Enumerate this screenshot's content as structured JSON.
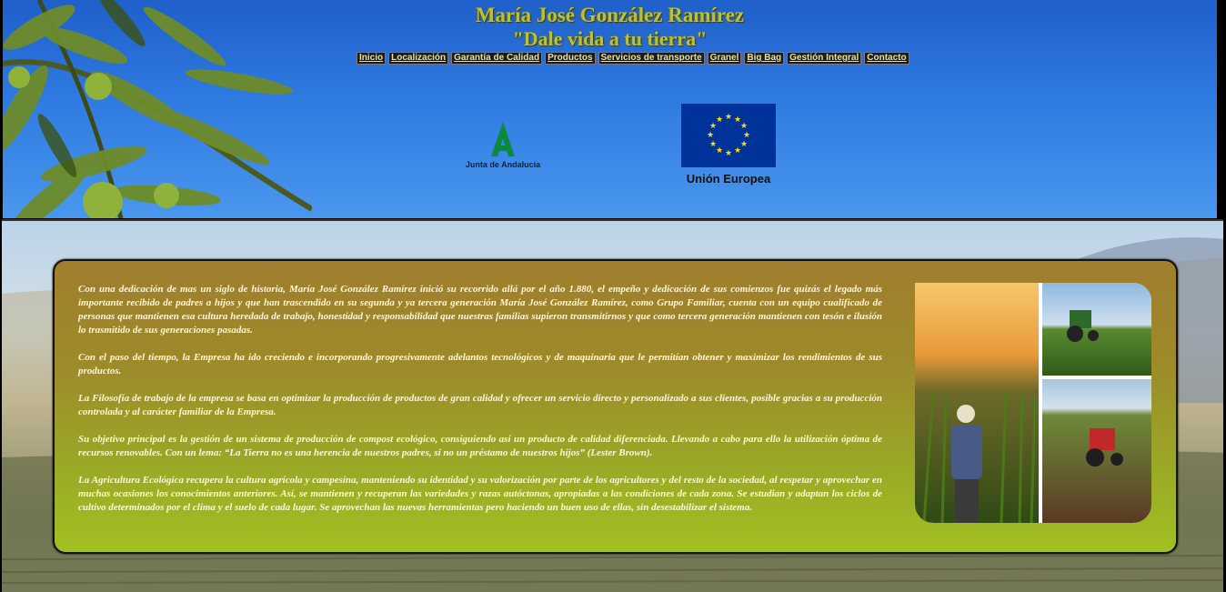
{
  "header": {
    "title": "María José González Ramírez",
    "slogan": "\"Dale vida a tu tierra\"",
    "nav": [
      {
        "label": "Inicio"
      },
      {
        "label": "Localización"
      },
      {
        "label": "Garantía de Calidad"
      },
      {
        "label": "Productos"
      },
      {
        "label": "Servicios de transporte"
      },
      {
        "label": "Granel"
      },
      {
        "label": "Big Bag"
      },
      {
        "label": "Gestión Integral"
      },
      {
        "label": "Contacto"
      }
    ],
    "logos": {
      "junta": "Junta de Andalucía",
      "eu": "Unión Europea"
    }
  },
  "main": {
    "paragraphs": [
      "Con una dedicación de mas un siglo de historia, María José González Ramírez inició su recorrido allá por el año 1.880, el empeño y dedicación de sus comienzos fue quizás el legado más importante recibido de padres a hijos y que han trascendido en su segunda y ya tercera generación María José González Ramírez, como Grupo Familiar, cuenta con un equipo cualificado de personas que mantienen esa cultura heredada de trabajo, honestidad y responsabilidad que nuestras familias supieron transmitirnos y que como tercera generación mantienen con tesón e ilusión lo trasmitido de sus generaciones pasadas.",
      "Con el paso del tiempo, la Empresa ha ido creciendo e incorporando progresivamente adelantos tecnológicos y de maquinaria que le permitían obtener y maximizar los rendimientos de sus productos.",
      "La Filosofía de trabajo de la empresa se basa en optimizar la producción de productos de gran calidad y ofrecer un servicio directo y personalizado a sus clientes, posible gracias a su producción controlada y al carácter familiar de la Empresa.",
      "Su objetivo principal es la gestión de un sistema de producción de compost ecológico, consiguiendo así un producto de calidad diferenciada. Llevando a cabo para ello la utilización óptima de recursos renovables. Con un lema: “La Tierra no es una herencia de nuestros padres, si no un préstamo de nuestros hijos” (Lester Brown).",
      "La Agricultura Ecológica recupera la cultura agrícola y campesina, manteniendo su identidad y su valorización por parte de los agricultores y del resto de la sociedad, al respetar y aprovechar en muchas ocasiones los conocimientos anteriores. Así, se mantienen y recuperan las variedades y razas autóctonas, apropiadas a las condiciones de cada zona. Se estudian y adaptan los ciclos de cultivo determinados por el clima y el suelo de cada lugar. Se aprovechan las nuevas herramientas pero haciendo un buen uso de ellas, sin desestabilizar el sistema."
    ]
  },
  "colors": {
    "title": "#b7c23c",
    "header_sky": "#2e7ae0",
    "box_top": "#a07e2e",
    "box_bottom": "#a1c021",
    "text": "#fff7d6",
    "eu_blue": "#003399",
    "eu_star": "#ffdd00",
    "junta_green": "#0b8a3b"
  },
  "icons": {
    "header_image": "olive-branch",
    "junta_logo": "junta-andalucia-logo",
    "eu_logo": "eu-flag",
    "collage": "farming-photo-collage"
  }
}
